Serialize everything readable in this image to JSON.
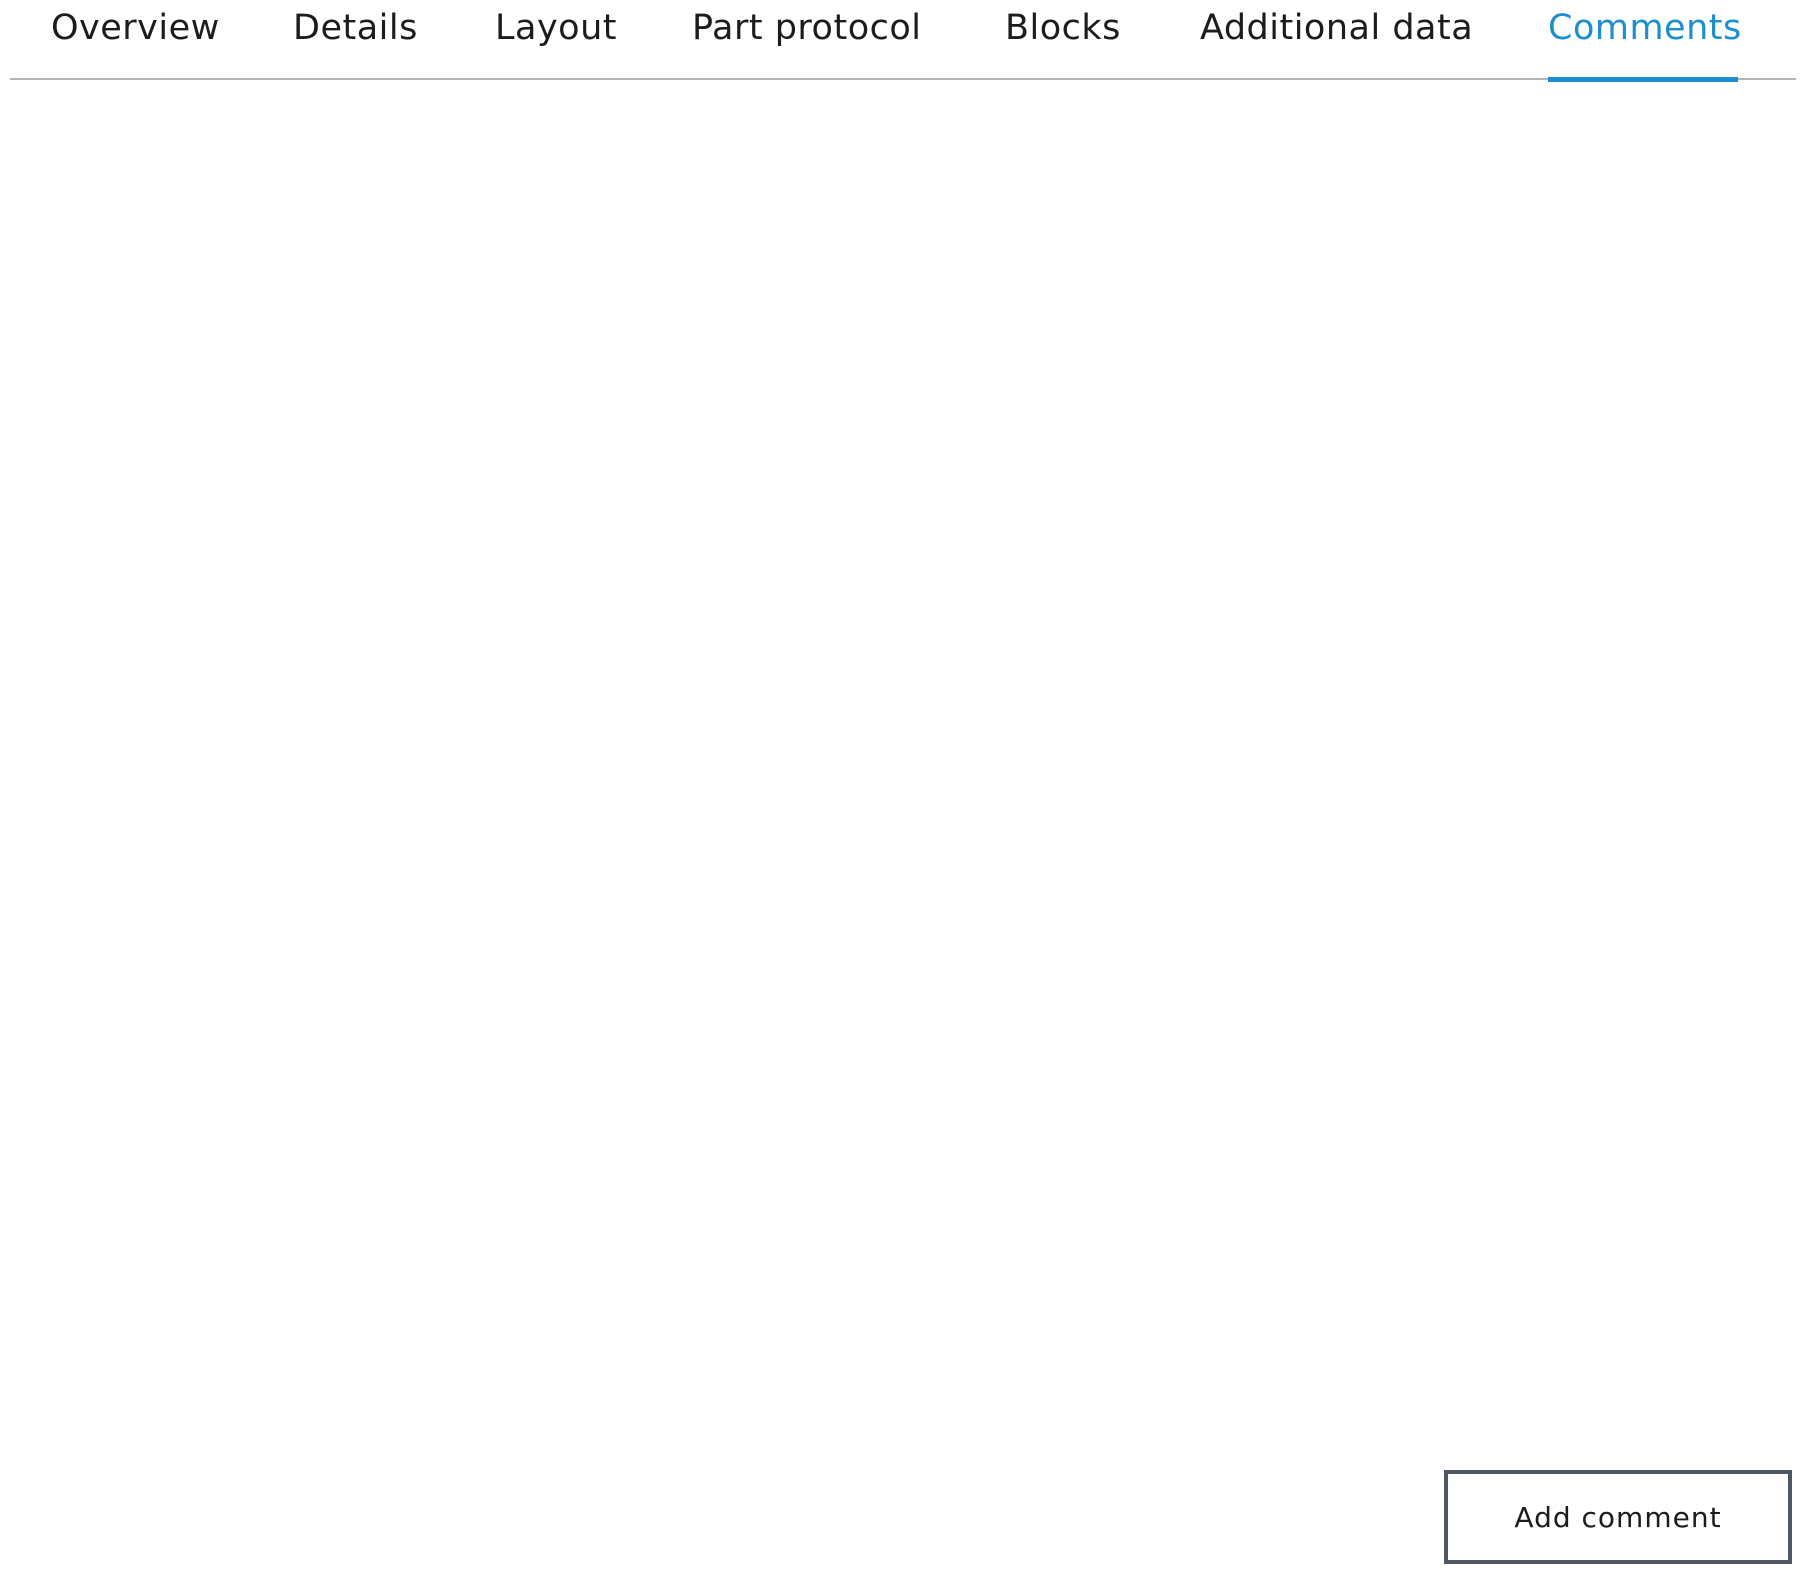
{
  "tabs": [
    {
      "label": "Overview",
      "active": false
    },
    {
      "label": "Details",
      "active": false
    },
    {
      "label": "Layout",
      "active": false
    },
    {
      "label": "Part protocol",
      "active": false
    },
    {
      "label": "Blocks",
      "active": false
    },
    {
      "label": "Additional data",
      "active": false
    },
    {
      "label": "Comments",
      "active": true
    }
  ],
  "actions": {
    "add_comment_label": "Add comment"
  },
  "colors": {
    "accent": "#1d8fcc",
    "text": "#1a1c1e",
    "divider": "#b3b6b8",
    "button_border": "#4f5862"
  }
}
